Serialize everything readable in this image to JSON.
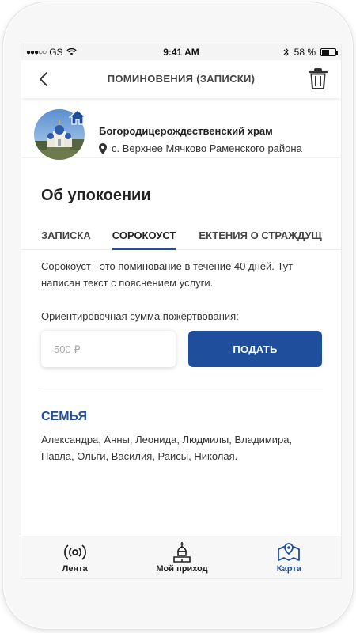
{
  "statusbar": {
    "carrier": "GS",
    "time": "9:41 AM",
    "battery_text": "58 %",
    "battery_level": 0.58
  },
  "header": {
    "title": "ПОМИНОВЕНИЯ (ЗАПИСКИ)",
    "back_icon": "chevron-left-icon",
    "trash_icon": "trash-icon"
  },
  "church": {
    "name": "Богородицерождественский храм",
    "address": "с. Верхнее Мячково Раменского района"
  },
  "section": {
    "title": "Об упокоении"
  },
  "tabs": [
    {
      "label": "ЗАПИСКА",
      "active": false
    },
    {
      "label": "СОРОКОУСТ",
      "active": true
    },
    {
      "label": "ЕКТЕНИЯ О СТРАЖДУЩ",
      "active": false
    }
  ],
  "description": "Сорокоуст - это поминование в течение 40 дней. Тут написан текст с пояснением услуги.",
  "donation": {
    "label": "Ориентировочная сумма пожертвования:",
    "placeholder": "500 ₽",
    "submit_label": "ПОДАТЬ"
  },
  "group": {
    "title": "СЕМЬЯ",
    "names": "Александра, Анны, Леонида, Людмилы, Владимира, Павла, Ольги, Василия, Раисы, Николая."
  },
  "tabbar": {
    "items": [
      {
        "label": "Лента",
        "icon": "broadcast-icon",
        "active": false
      },
      {
        "label": "Мой приход",
        "icon": "church-icon",
        "active": false
      },
      {
        "label": "Карта",
        "icon": "map-icon",
        "active": true
      }
    ]
  },
  "colors": {
    "accent": "#1f4f9c"
  }
}
